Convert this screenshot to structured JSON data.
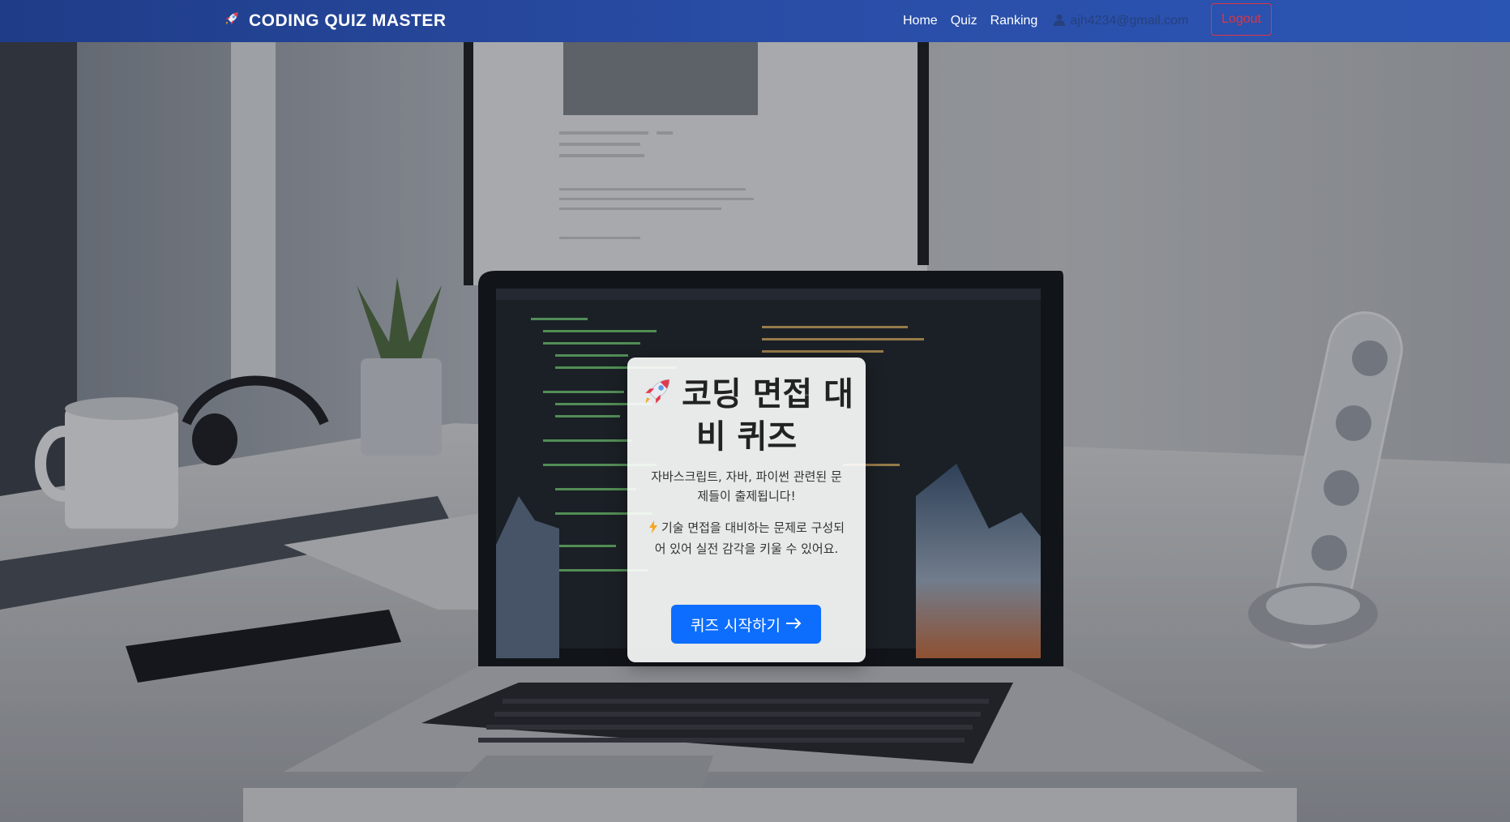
{
  "navbar": {
    "brand_text": "CODING QUIZ MASTER",
    "brand_icon": "rocket-icon",
    "links": [
      "Home",
      "Quiz",
      "Ranking"
    ],
    "user_icon": "user-icon",
    "user_email": "ajh4234@gmail.com",
    "logout_label": "Logout"
  },
  "hero": {
    "title": "코딩 면접 대비 퀴즈",
    "title_icon": "rocket-icon",
    "description": "자바스크립트, 자바, 파이썬 관련된 문제들이 출제됩니다!",
    "note_icon": "lightning-icon",
    "note": "기술 면접을 대비하는 문제로 구성되어 있어 실전 감각을 키울 수 있어요.",
    "start_button_label": "퀴즈 시작하기",
    "start_button_icon": "arrow-right-icon"
  },
  "colors": {
    "navbar": "#2a4ea8",
    "primary_button": "#0d6efd",
    "logout": "#dc3545"
  }
}
